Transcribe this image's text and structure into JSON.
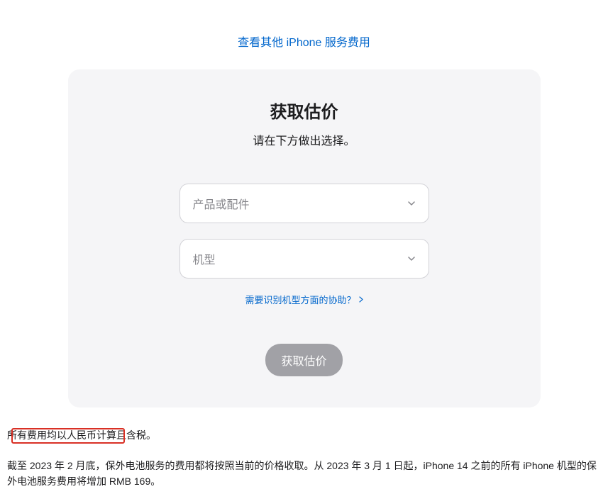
{
  "topLink": "查看其他 iPhone 服务费用",
  "card": {
    "title": "获取估价",
    "subtitle": "请在下方做出选择。",
    "select1": "产品或配件",
    "select2": "机型",
    "helpLink": "需要识别机型方面的协助？",
    "submitBtn": "获取估价"
  },
  "footer": {
    "note1": "所有费用均以人民币计算且含税。",
    "note2": "截至 2023 年 2 月底，保外电池服务的费用都将按照当前的价格收取。从 2023 年 3 月 1 日起，iPhone 14 之前的所有 iPhone 机型的保外电池服务费用将增加 RMB 169。"
  }
}
